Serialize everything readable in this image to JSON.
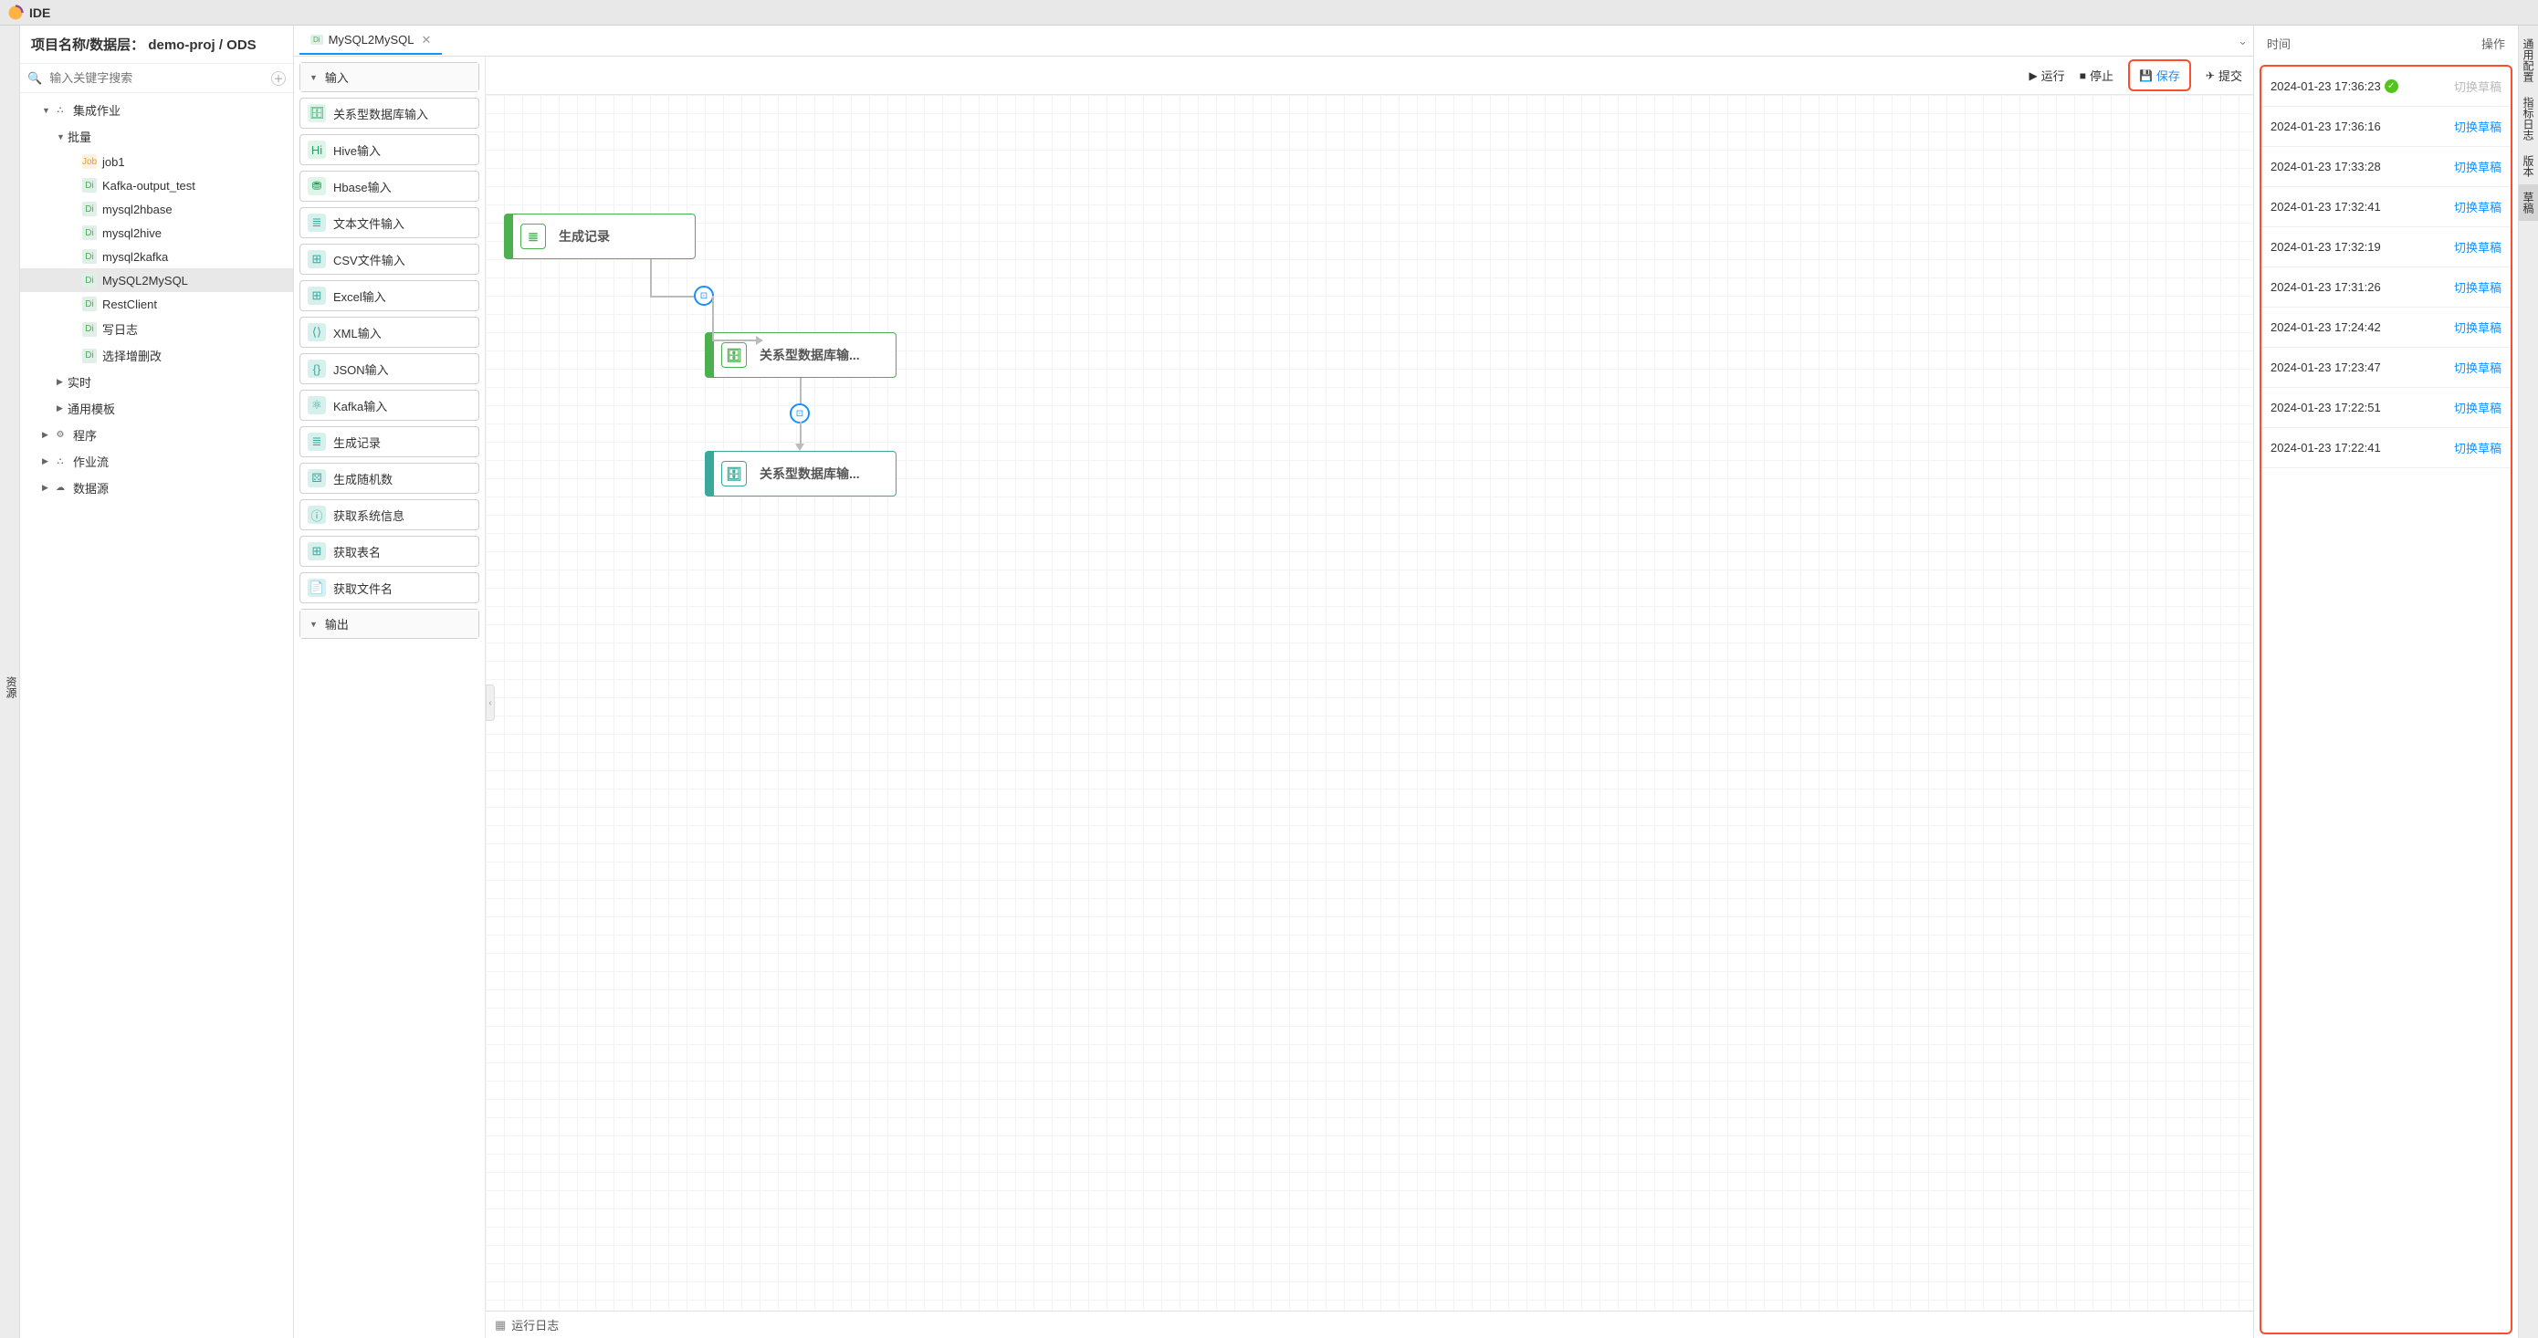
{
  "topbar": {
    "title": "IDE"
  },
  "leftRail": {
    "label": "资源"
  },
  "sidebar": {
    "header": "项目名称/数据层： demo-proj / ODS",
    "searchPlaceholder": "输入关键字搜索",
    "tree": {
      "integrationJobs": "集成作业",
      "batch": "批量",
      "jobs": [
        "job1",
        "Kafka-output_test",
        "mysql2hbase",
        "mysql2hive",
        "mysql2kafka",
        "MySQL2MySQL",
        "RestClient",
        "写日志",
        "选择增删改"
      ],
      "realtime": "实时",
      "commonTemplate": "通用模板",
      "program": "程序",
      "workflow": "作业流",
      "datasource": "数据源"
    }
  },
  "tab": {
    "label": "MySQL2MySQL"
  },
  "actions": {
    "run": "运行",
    "stop": "停止",
    "save": "保存",
    "submit": "提交"
  },
  "palette": {
    "inputHeader": "输入",
    "outputHeader": "输出",
    "items": [
      "关系型数据库输入",
      "Hive输入",
      "Hbase输入",
      "文本文件输入",
      "CSV文件输入",
      "Excel输入",
      "XML输入",
      "JSON输入",
      "Kafka输入",
      "生成记录",
      "生成随机数",
      "获取系统信息",
      "获取表名",
      "获取文件名"
    ]
  },
  "canvas": {
    "node1": "生成记录",
    "node2": "关系型数据库输...",
    "node3": "关系型数据库输..."
  },
  "statusBar": {
    "log": "运行日志"
  },
  "history": {
    "colTime": "时间",
    "colAction": "操作",
    "actionLabel": "切换草稿",
    "rows": [
      {
        "time": "2024-01-23 17:36:23",
        "current": true
      },
      {
        "time": "2024-01-23 17:36:16",
        "current": false
      },
      {
        "time": "2024-01-23 17:33:28",
        "current": false
      },
      {
        "time": "2024-01-23 17:32:41",
        "current": false
      },
      {
        "time": "2024-01-23 17:32:19",
        "current": false
      },
      {
        "time": "2024-01-23 17:31:26",
        "current": false
      },
      {
        "time": "2024-01-23 17:24:42",
        "current": false
      },
      {
        "time": "2024-01-23 17:23:47",
        "current": false
      },
      {
        "time": "2024-01-23 17:22:51",
        "current": false
      },
      {
        "time": "2024-01-23 17:22:41",
        "current": false
      }
    ]
  },
  "rightRail": {
    "items": [
      "通用配置",
      "指标日志",
      "版本",
      "草稿"
    ]
  }
}
